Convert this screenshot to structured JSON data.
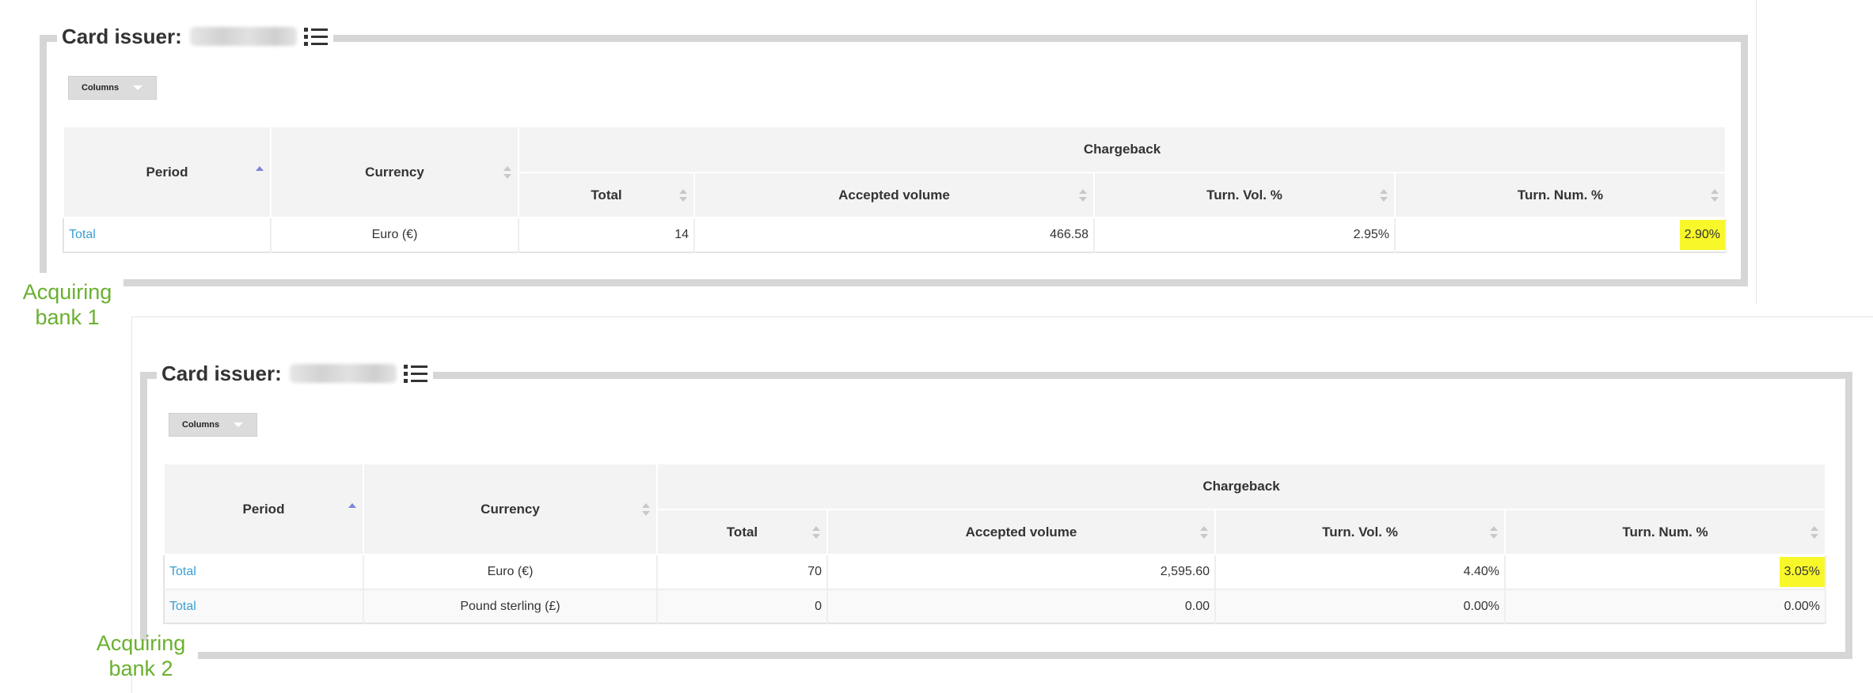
{
  "panels": [
    {
      "card_issuer_label": "Card issuer:",
      "columns_button": "Columns",
      "headers": {
        "period": "Period",
        "currency": "Currency",
        "chargeback": "Chargeback",
        "total": "Total",
        "accepted_volume": "Accepted volume",
        "turn_vol": "Turn. Vol. %",
        "turn_num": "Turn. Num. %"
      },
      "rows": [
        {
          "period": "Total",
          "currency": "Euro (€)",
          "total": "14",
          "accepted_volume": "466.58",
          "turn_vol": "2.95%",
          "turn_num": "2.90%",
          "turn_num_highlight": true
        }
      ],
      "bank_label": [
        "Acquiring",
        "bank 1"
      ]
    },
    {
      "card_issuer_label": "Card issuer:",
      "columns_button": "Columns",
      "headers": {
        "period": "Period",
        "currency": "Currency",
        "chargeback": "Chargeback",
        "total": "Total",
        "accepted_volume": "Accepted volume",
        "turn_vol": "Turn. Vol. %",
        "turn_num": "Turn. Num. %"
      },
      "rows": [
        {
          "period": "Total",
          "currency": "Euro (€)",
          "total": "70",
          "accepted_volume": "2,595.60",
          "turn_vol": "4.40%",
          "turn_num": "3.05%",
          "turn_num_highlight": true
        },
        {
          "period": "Total",
          "currency": "Pound sterling (£)",
          "total": "0",
          "accepted_volume": "0.00",
          "turn_vol": "0.00%",
          "turn_num": "0.00%",
          "turn_num_highlight": false
        }
      ],
      "bank_label": [
        "Acquiring",
        "bank 2"
      ]
    }
  ],
  "colors": {
    "annotation_green": "#6ab02f",
    "highlight_yellow": "#f7f72a",
    "link_blue": "#3a9fd5",
    "frame_gray": "#d6d6d6"
  },
  "icons": [
    "list-icon",
    "sort-asc-icon",
    "sort-both-icon",
    "caret-down-icon"
  ]
}
